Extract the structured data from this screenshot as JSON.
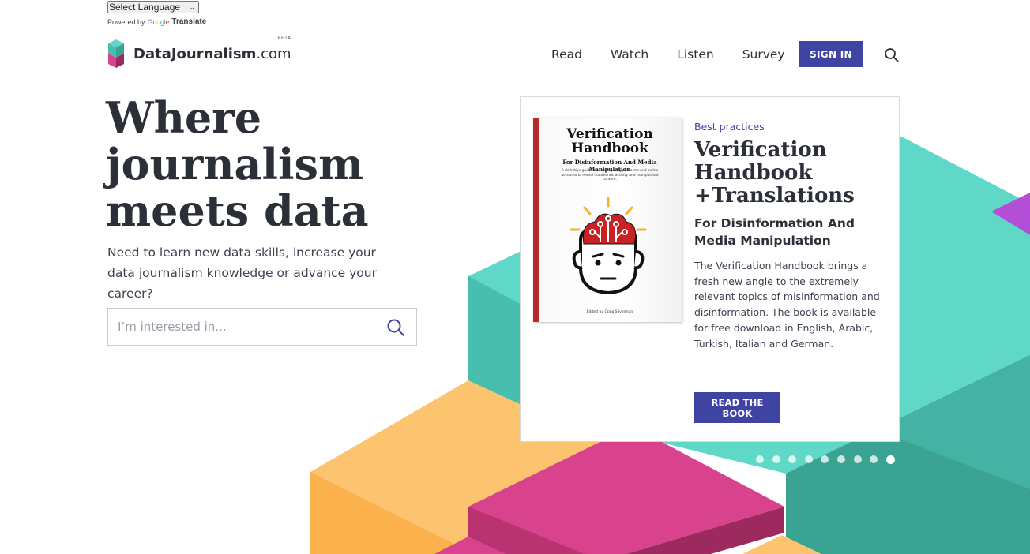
{
  "translate": {
    "select_label": "Select Language",
    "powered_by": "Powered by",
    "google": [
      "G",
      "o",
      "o",
      "g",
      "l",
      "e"
    ],
    "translate_link": "Translate"
  },
  "header": {
    "logo_name": "DataJournalism",
    "logo_tld": ".com",
    "beta": "BETA",
    "nav": [
      "Read",
      "Watch",
      "Listen",
      "Survey"
    ],
    "signin_label": "SIGN IN",
    "search_icon": "search-icon"
  },
  "hero": {
    "title": "Where journalism meets data",
    "subtitle": "Need to learn new data skills, increase your data journalism knowledge or advance your career?",
    "search_placeholder": "I’m interested in...",
    "search_value": ""
  },
  "card": {
    "category": "Best practices",
    "title": "Verification Handbook +Translations",
    "subtitle": "For Disinformation And Media Manipulation",
    "description": "The Verification Handbook brings a fresh new angle to the extremely relevant topics of misinformation and disinformation. The book is available for free download in English, Arabic, Turkish, Italian and German.",
    "button_label": "READ THE BOOK",
    "book": {
      "title": "Verification Handbook",
      "subtitle": "For Disinformation And Media Manipulation",
      "blurb": "A definitive guide for investigating platforms and online accounts to reveal inauthentic activity and manipulated content.",
      "editor": "Edited by Craig Silverman",
      "spine_color": "#b52a2a"
    }
  },
  "carousel": {
    "dot_count": 9,
    "active_index": 8
  },
  "colors": {
    "accent": "#3f43a1",
    "text": "#2b2f38",
    "teal": "#5fd8c8",
    "teal_dark": "#3aa394",
    "yellow": "#fdc46f",
    "magenta": "#d9438d",
    "purple": "#b24fd6"
  }
}
